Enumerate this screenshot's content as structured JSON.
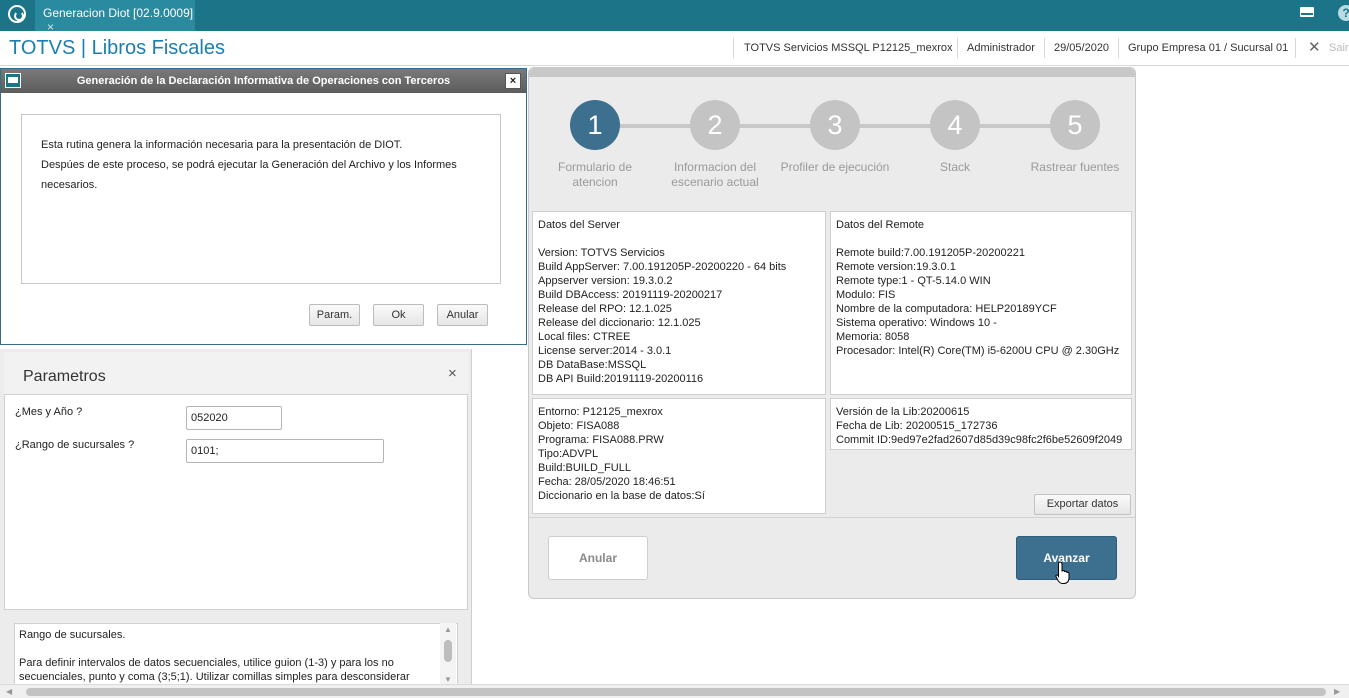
{
  "tab": {
    "label": "Generacion Diot [02.9.0009]",
    "close": "×"
  },
  "header": {
    "app_title": "TOTVS | Libros Fiscales",
    "server": "TOTVS Servicios MSSQL P12125_mexrox",
    "user": "Administrador",
    "date": "29/05/2020",
    "company": "Grupo Empresa 01 / Sucursal 01",
    "exit": "Sair"
  },
  "dialog": {
    "title": "Generación de la Declaración Informativa de Operaciones con Terceros",
    "close": "×",
    "lines": [
      "Esta rutina genera la información necesaria para la presentación de  DIOT.",
      "Despúes de este proceso, se podrá ejecutar la Generación del Archivo y los Informes",
      "necesarios."
    ],
    "buttons": {
      "param": "Param.",
      "ok": "Ok",
      "anular": "Anular"
    }
  },
  "params": {
    "title": "Parametros",
    "close": "×",
    "fields": [
      {
        "label": "¿Mes y Año ?",
        "value": "052020"
      },
      {
        "label": "¿Rango de sucursales ?",
        "value": "0101;"
      }
    ],
    "help_title": "Rango de sucursales.",
    "help_text": "Para definir intervalos de datos secuenciales, utilice guion (1-3) y para los no secuenciales, punto y coma (3;5;1). Utilizar comillas simples para desconsiderar"
  },
  "wizard": {
    "steps": [
      {
        "num": "1",
        "label": "Formulario de atencion",
        "active": true
      },
      {
        "num": "2",
        "label": "Informacion del escenario actual",
        "active": false
      },
      {
        "num": "3",
        "label": "Profiler de ejecución",
        "active": false
      },
      {
        "num": "4",
        "label": "Stack",
        "active": false
      },
      {
        "num": "5",
        "label": "Rastrear fuentes",
        "active": false
      }
    ],
    "server_box": {
      "title": "Datos del Server",
      "lines": [
        "Version: TOTVS Servicios",
        "Build AppServer: 7.00.191205P-20200220 - 64 bits",
        "Appserver version: 19.3.0.2",
        "Build DBAccess: 20191119-20200217",
        "Release del RPO:  12.1.025",
        "Release del diccionario: 12.1.025",
        "Local files: CTREE",
        "License server:2014 - 3.0.1",
        "DB DataBase:MSSQL",
        "DB API Build:20191119-20200116"
      ]
    },
    "remote_box": {
      "title": "Datos del Remote",
      "lines": [
        "Remote build:7.00.191205P-20200221",
        "Remote version:19.3.0.1",
        "Remote type:1 - QT-5.14.0 WIN",
        "Modulo: FIS",
        "Nombre de la computadora: HELP20189YCF",
        "Sistema operativo: Windows 10 -",
        "Memoria: 8058",
        "Procesador: Intel(R) Core(TM) i5-6200U CPU @ 2.30GHz"
      ]
    },
    "env_box": {
      "lines": [
        "Entorno: P12125_mexrox",
        "Objeto: FISA088",
        "Programa: FISA088.PRW",
        "Tipo:ADVPL",
        "Build:BUILD_FULL",
        "Fecha: 28/05/2020 18:46:51",
        "Diccionario en la base de datos:Sí"
      ]
    },
    "lib_box": {
      "lines": [
        "Versión de la Lib:20200615",
        "Fecha de Lib: 20200515_172736",
        "Commit ID:9ed97e2fad2607d85d39c98fc2f6be52609f2049"
      ]
    },
    "export_label": "Exportar datos",
    "cancel_label": "Anular",
    "next_label": "Avanzar"
  },
  "colors": {
    "topbar": "#1c7489",
    "accent": "#3d6f8f",
    "title_blue": "#1a7fb0"
  }
}
